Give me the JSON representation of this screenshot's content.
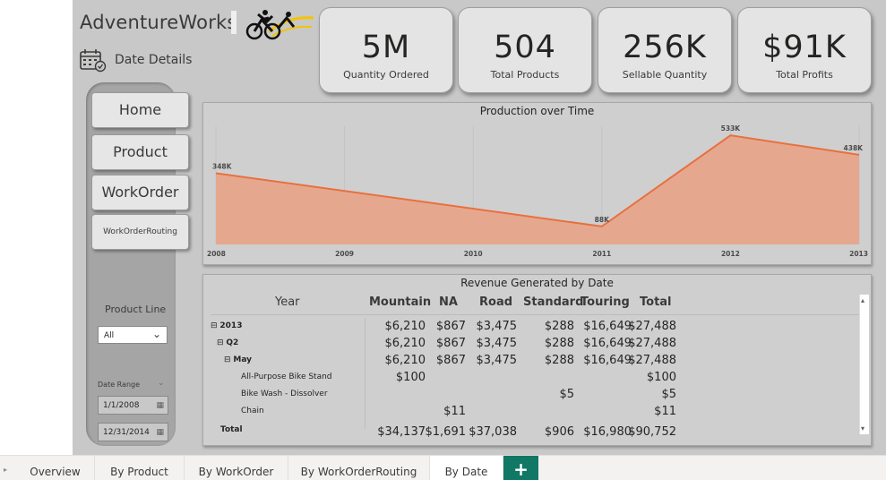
{
  "header": {
    "brand": "AdventureWorks",
    "page_title": "Date Details"
  },
  "kpis": [
    {
      "value": "5M",
      "label": "Quantity Ordered"
    },
    {
      "value": "504",
      "label": "Total Products"
    },
    {
      "value": "256K",
      "label": "Sellable Quantity"
    },
    {
      "value": "$91K",
      "label": "Total Profits"
    }
  ],
  "nav": {
    "home": "Home",
    "product": "Product",
    "workorder": "WorkOrder",
    "workorderrouting": "WorkOrderRouting"
  },
  "slicers": {
    "product_line_title": "Product Line",
    "product_line_value": "All",
    "date_range_title": "Date Range",
    "date_start": "1/1/2008",
    "date_end": "12/31/2014"
  },
  "chart_data": {
    "type": "area",
    "title": "Production over Time",
    "x": [
      "2008",
      "2009",
      "2010",
      "2011",
      "2012",
      "2013"
    ],
    "series": [
      {
        "values": [
          348,
          null,
          null,
          88,
          533,
          438
        ],
        "data_labels": [
          "348K",
          "",
          "",
          "88K",
          "533K",
          "438K"
        ]
      }
    ],
    "colors": {
      "fill": "#e5a88f",
      "line": "#e8703f"
    }
  },
  "matrix": {
    "title": "Revenue Generated by Date",
    "headers": {
      "year": "Year",
      "mountain": "Mountain",
      "na": "NA",
      "road": "Road",
      "standard": "Standard",
      "touring": "Touring",
      "total": "Total"
    },
    "rows": [
      {
        "label": "2013",
        "expand": "⊟",
        "mountain": "$6,210",
        "na": "$867",
        "road": "$3,475",
        "standard": "$288",
        "touring": "$16,649",
        "total": "$27,488"
      },
      {
        "label": "Q2",
        "expand": "⊟",
        "mountain": "$6,210",
        "na": "$867",
        "road": "$3,475",
        "standard": "$288",
        "touring": "$16,649",
        "total": "$27,488"
      },
      {
        "label": "May",
        "expand": "⊟",
        "mountain": "$6,210",
        "na": "$867",
        "road": "$3,475",
        "standard": "$288",
        "touring": "$16,649",
        "total": "$27,488"
      },
      {
        "label": "All-Purpose Bike Stand",
        "mountain": "$100",
        "total": "$100"
      },
      {
        "label": "Bike Wash - Dissolver",
        "standard": "$5",
        "total": "$5"
      },
      {
        "label": "Chain",
        "na": "$11",
        "total": "$11"
      }
    ],
    "total_row": {
      "label": "Total",
      "mountain": "$34,137",
      "na": "$1,691",
      "road": "$37,038",
      "standard": "$906",
      "touring": "$16,980",
      "total": "$90,752"
    }
  },
  "tabs": [
    "Overview",
    "By Product",
    "By WorkOrder",
    "By WorkOrderRouting",
    "By Date"
  ],
  "active_tab": "By Date",
  "icons": {
    "calendar": "calendar-icon",
    "cyclist_logo": "cyclist-logo",
    "chevron": "chevron-down-icon",
    "add": "plus-icon"
  }
}
